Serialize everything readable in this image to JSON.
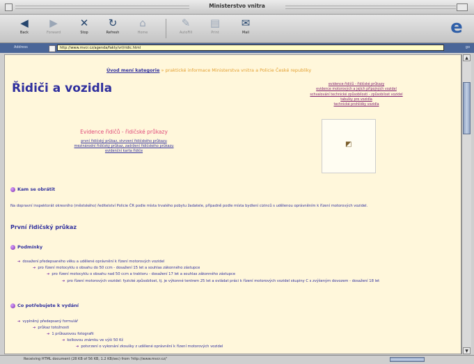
{
  "window": {
    "title": "Ministerstvo vnitra"
  },
  "toolbar": {
    "buttons": [
      {
        "label": "Back",
        "icon": "back-arrow-icon",
        "enabled": true
      },
      {
        "label": "Forward",
        "icon": "forward-arrow-icon",
        "enabled": false
      },
      {
        "label": "Stop",
        "icon": "stop-icon",
        "enabled": true
      },
      {
        "label": "Refresh",
        "icon": "refresh-icon",
        "enabled": true
      },
      {
        "label": "Home",
        "icon": "home-icon",
        "enabled": false
      },
      {
        "label": "AutoFill",
        "icon": "autofill-icon",
        "enabled": false
      },
      {
        "label": "Print",
        "icon": "print-icon",
        "enabled": false
      },
      {
        "label": "Mail",
        "icon": "mail-icon",
        "enabled": true
      }
    ]
  },
  "address": {
    "label": "Address",
    "url": "http://www.mvcr.cz/agenda/fakty/vrl/ridic.html",
    "go": "go"
  },
  "page": {
    "breadcrumb_home": "Úvod mení kategorie",
    "breadcrumb_rest": " » praktické informace Ministerstva vnitra a Policie České republiky",
    "title": "Řidiči a vozidla",
    "right_links": [
      "evidence řidičů - řidičské průkazy",
      "evidence motorových a jejich přípojných vozidel",
      "schvalování technické způsobilosti - způsobilost vozidel",
      "tabulky pro vozidla",
      "technické prohlídky vozidla"
    ],
    "evidence_title": "Evidence řidičů - řidičské průkazy",
    "evidence_links": [
      "první řidičský průkaz, stvrzení řidičského průkazu",
      "mezinárodní řidičský průkaz, zadržení řidičského průkazu",
      "evidenční karta řidiče"
    ],
    "section_kam": "Kam se obrátit",
    "para": "Na dopravní inspektorát okresního (městského) ředitelství Policie ČR podle místa trvalého pobytu žadatele, případně podle místa bydlení cizinců s udělenou oprávněním k řízení motorových vozidel.",
    "h2": "První řidičský průkaz",
    "section_podminky": "Podmínky",
    "podminky": [
      "dosažení předepsaného věku a udělené oprávnění k řízení motorových vozidel",
      "pro řízení motocyklu o obsahu do 50 ccm - dosažení 15 let a souhlas zákonného zástupce",
      "pro řízení motocyklu o obsahu nad 50 ccm a traktoru - dosažení 17 let a souhlas zákonného zástupce",
      "pro řízení motorových vozidel: fyzické způsobilost, tj. je výkonné tentrem 25 let a ovládat práci k řízení motorových vozidel skupiny C s zvýšeným dovozem - dosažení 18 let"
    ],
    "section_co": "Co potřebujete k vydání",
    "co": [
      "vyplněný předepsaný formulář",
      "průkaz totožnosti",
      "1 průkazovou fotografii",
      "kolkovou známku ve výši 50 Kč",
      "potvrzení o vykonání zkoušky z udělené oprávnění k řízení motorových vozidel"
    ]
  },
  "status": {
    "text": "Receiving HTML document (28 KB of 56 KB, 1.2 KB/sec) from 'http://www.mvcr.cz/'"
  }
}
